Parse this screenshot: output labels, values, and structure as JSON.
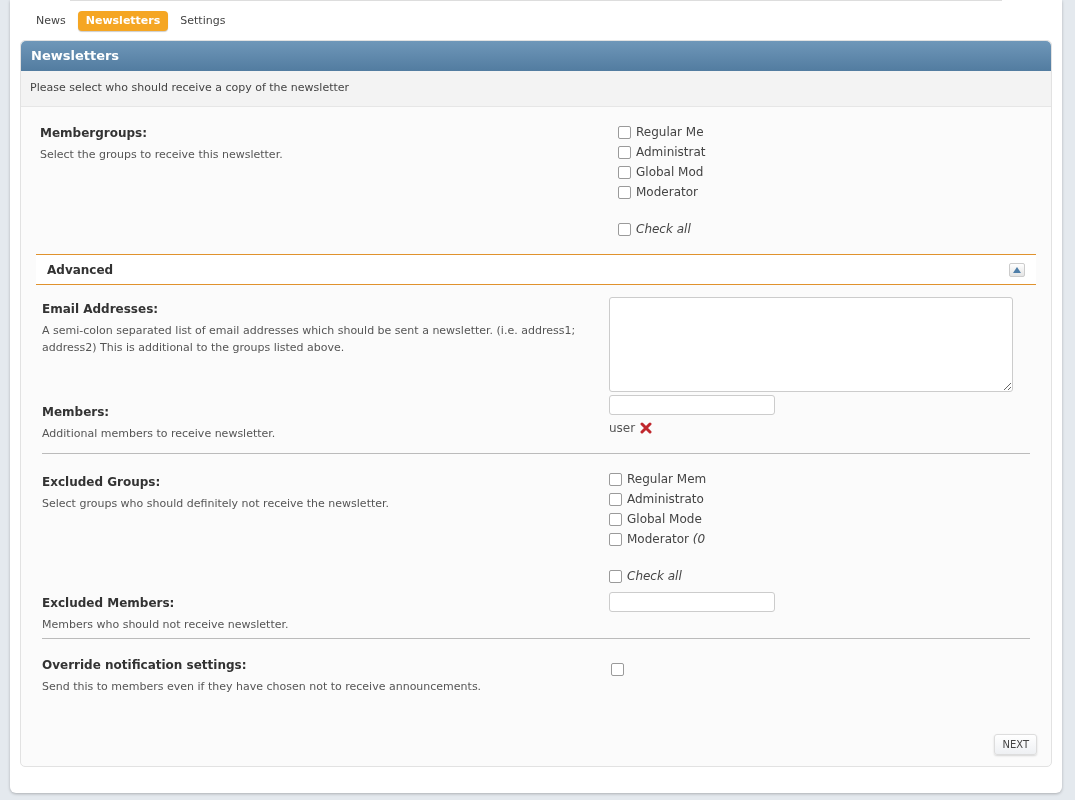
{
  "tabs": [
    {
      "label": "News",
      "selected": false
    },
    {
      "label": "Newsletters",
      "selected": true
    },
    {
      "label": "Settings",
      "selected": false
    }
  ],
  "panel": {
    "title": "Newsletters",
    "description": "Please select who should receive a copy of the newsletter"
  },
  "membergroups": {
    "label": "Membergroups:",
    "help": "Select the groups to receive this newsletter.",
    "groups": [
      {
        "label": "Regular Me",
        "checked": false
      },
      {
        "label": "Administrat",
        "checked": false
      },
      {
        "label": "Global Mod",
        "checked": false
      },
      {
        "label": "Moderator",
        "checked": false
      }
    ],
    "check_all": {
      "label": "Check all",
      "checked": false
    }
  },
  "advanced": {
    "title": "Advanced",
    "expanded": true,
    "email": {
      "label": "Email Addresses:",
      "help": "A semi-colon separated list of email addresses which should be sent a newsletter. (i.e. address1; address2) This is additional to the groups listed above."
    },
    "members": {
      "label": "Members:",
      "help": "Additional members to receive newsletter.",
      "tokens": [
        "user"
      ]
    },
    "excluded_groups": {
      "label": "Excluded Groups:",
      "help": "Select groups who should definitely not receive the newsletter.",
      "groups": [
        {
          "label": "Regular Mem",
          "checked": false
        },
        {
          "label": "Administrato",
          "checked": false
        },
        {
          "label": "Global Mode",
          "checked": false
        },
        {
          "label": "Moderator *(0*",
          "checked": false
        }
      ],
      "check_all": {
        "label": "Check all",
        "checked": false
      }
    },
    "excluded_members": {
      "label": "Excluded Members:",
      "help": "Members who should not receive newsletter."
    },
    "override": {
      "label": "Override notification settings:",
      "help": "Send this to members even if they have chosen not to receive announcements.",
      "checked": false
    }
  },
  "next_button": "NEXT"
}
